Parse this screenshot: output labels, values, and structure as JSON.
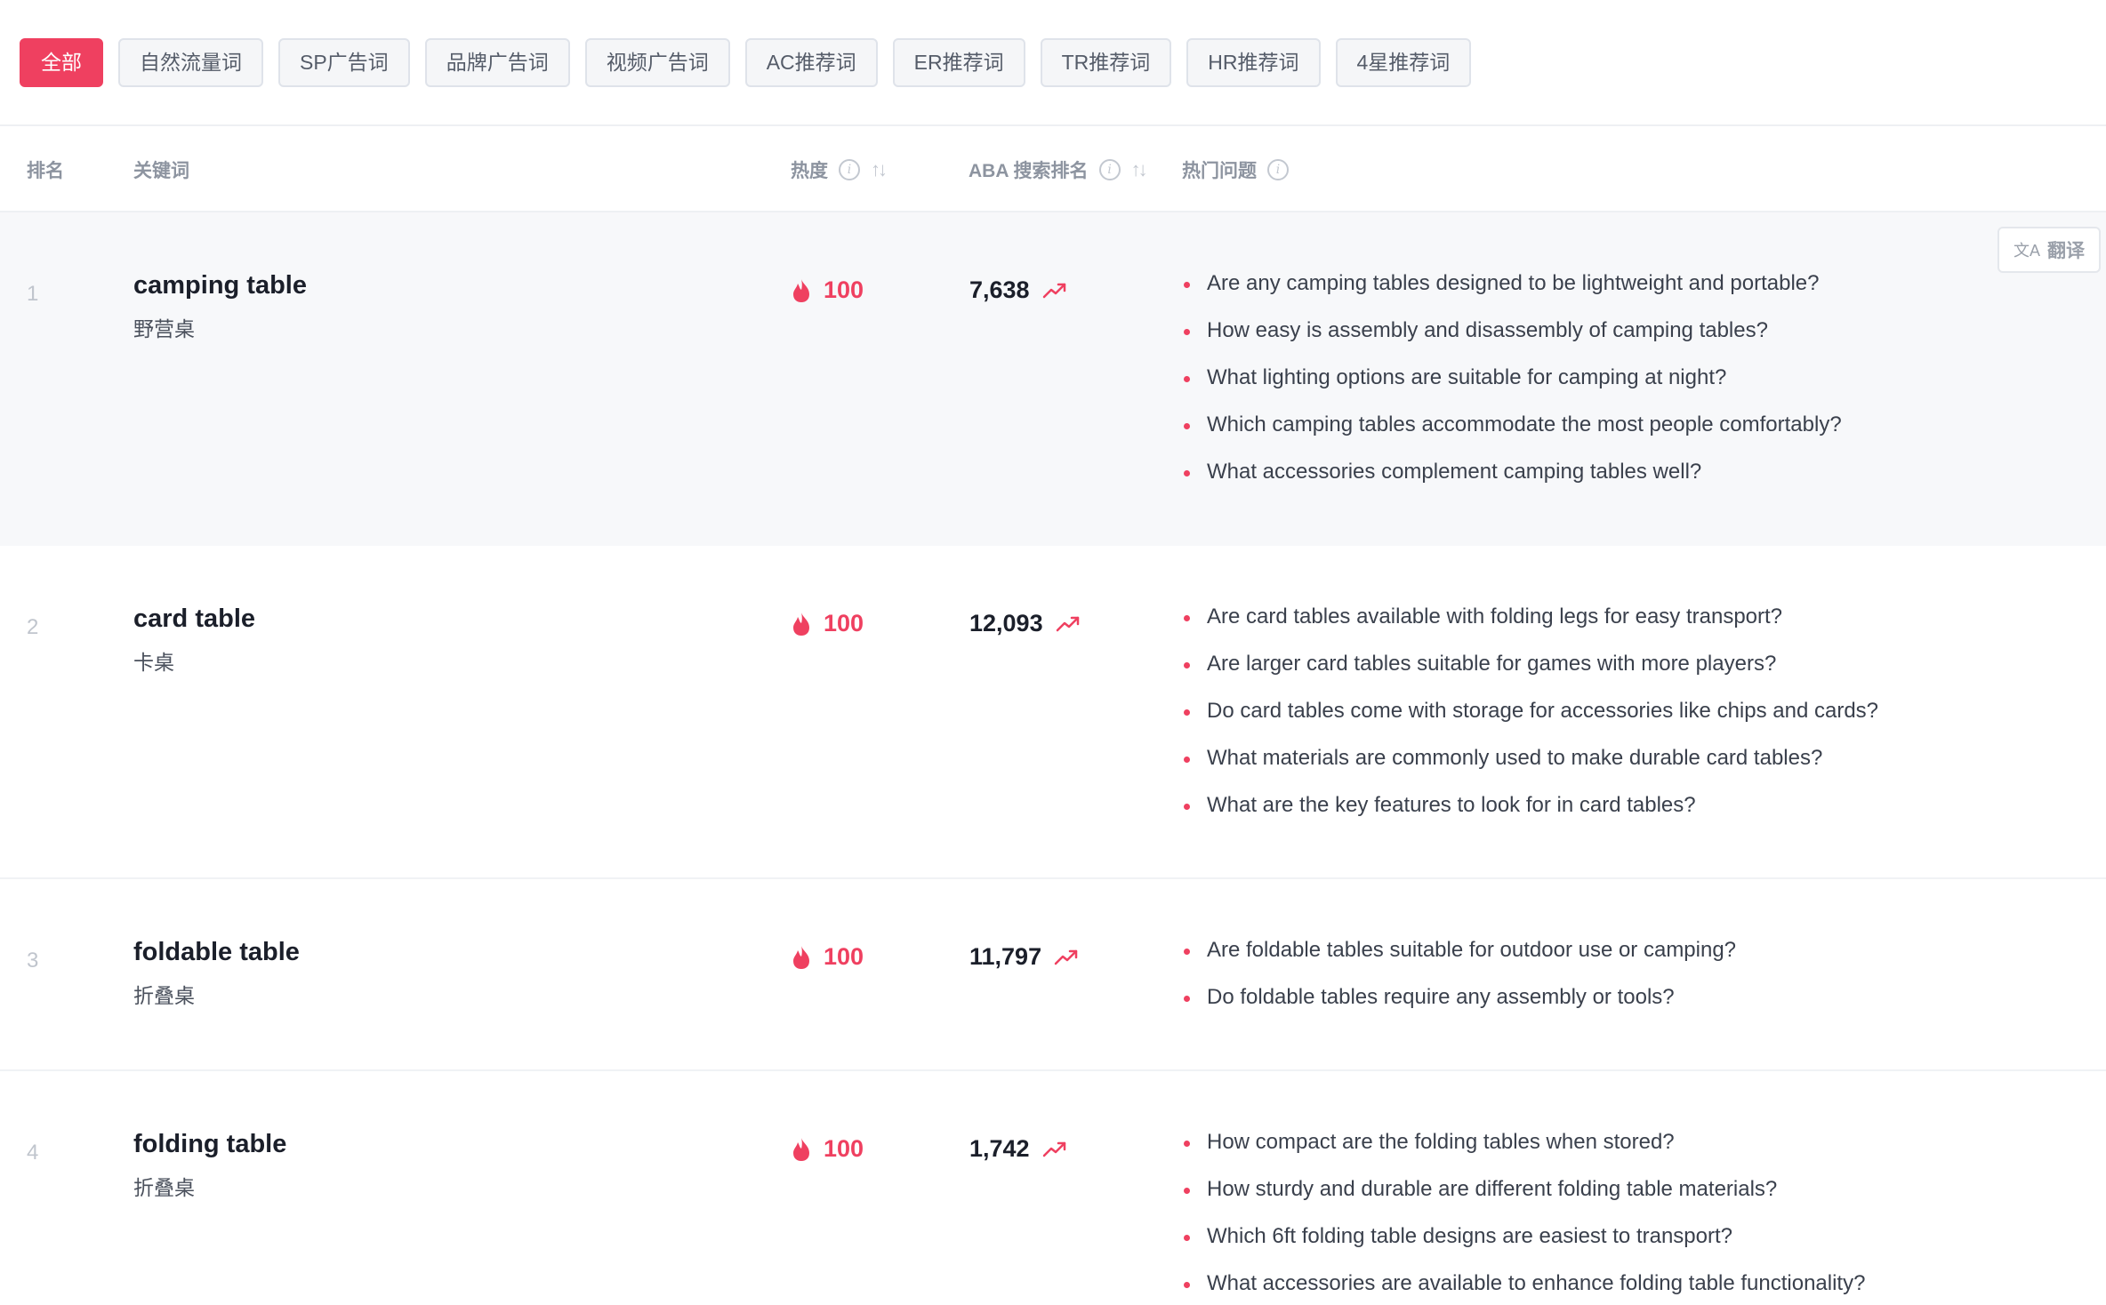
{
  "filters": [
    {
      "label": "全部",
      "active": true
    },
    {
      "label": "自然流量词"
    },
    {
      "label": "SP广告词"
    },
    {
      "label": "品牌广告词"
    },
    {
      "label": "视频广告词"
    },
    {
      "label": "AC推荐词"
    },
    {
      "label": "ER推荐词"
    },
    {
      "label": "TR推荐词"
    },
    {
      "label": "HR推荐词"
    },
    {
      "label": "4星推荐词"
    }
  ],
  "columns": {
    "rank": "排名",
    "keyword": "关键词",
    "heat": "热度",
    "aba": "ABA 搜索排名",
    "questions": "热门问题"
  },
  "translate_label": "翻译",
  "icons": {
    "heat": "flame-icon",
    "trend": "trending-up-icon",
    "info": "info-icon",
    "sort": "sort-icon",
    "translate": "translate-icon"
  },
  "colors": {
    "accent": "#ef4060",
    "hover_row": "#f7f8fa"
  },
  "rows": [
    {
      "rank": "1",
      "keyword": "camping table",
      "keyword_cn": "野营桌",
      "heat": "100",
      "aba": "7,638",
      "questions": [
        "Are any camping tables designed to be lightweight and portable?",
        "How easy is assembly and disassembly of camping tables?",
        "What lighting options are suitable for camping at night?",
        "Which camping tables accommodate the most people comfortably?",
        "What accessories complement camping tables well?"
      ]
    },
    {
      "rank": "2",
      "keyword": "card table",
      "keyword_cn": "卡桌",
      "heat": "100",
      "aba": "12,093",
      "questions": [
        "Are card tables available with folding legs for easy transport?",
        "Are larger card tables suitable for games with more players?",
        "Do card tables come with storage for accessories like chips and cards?",
        "What materials are commonly used to make durable card tables?",
        "What are the key features to look for in card tables?"
      ]
    },
    {
      "rank": "3",
      "keyword": "foldable table",
      "keyword_cn": "折叠桌",
      "heat": "100",
      "aba": "11,797",
      "questions": [
        "Are foldable tables suitable for outdoor use or camping?",
        "Do foldable tables require any assembly or tools?"
      ]
    },
    {
      "rank": "4",
      "keyword": "folding table",
      "keyword_cn": "折叠桌",
      "heat": "100",
      "aba": "1,742",
      "questions": [
        "How compact are the folding tables when stored?",
        "How sturdy and durable are different folding table materials?",
        "Which 6ft folding table designs are easiest to transport?",
        "What accessories are available to enhance folding table functionality?"
      ]
    }
  ]
}
